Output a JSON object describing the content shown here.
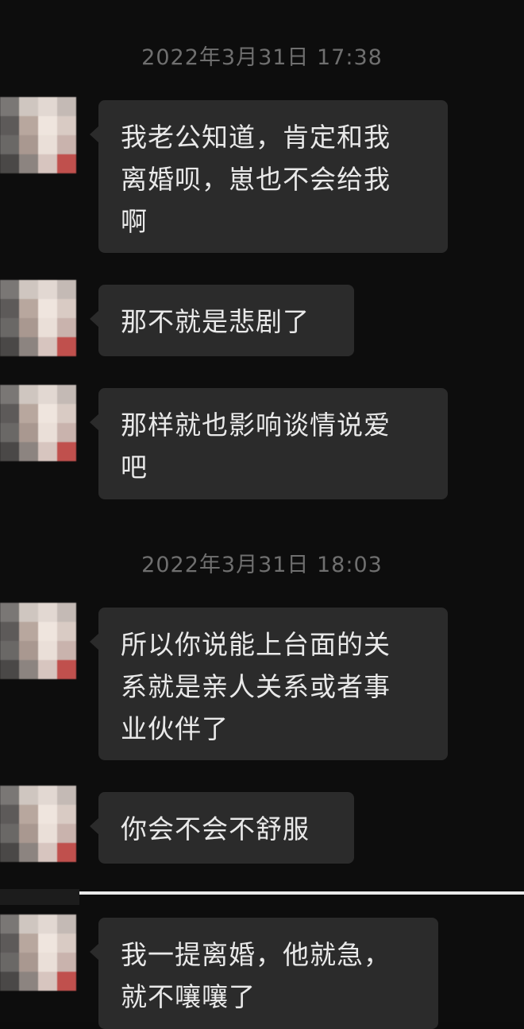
{
  "chat": {
    "timestamps": [
      "2022年3月31日 17:38",
      "2022年3月31日 18:03"
    ],
    "messages": [
      {
        "sender": "contact",
        "text": "我老公知道，肯定和我\n离婚呗，崽也不会给我\n啊"
      },
      {
        "sender": "contact",
        "text": "那不就是悲剧了"
      },
      {
        "sender": "contact",
        "text": "那样就也影响谈情说爱\n吧"
      },
      {
        "sender": "contact",
        "text": "所以你说能上台面的关\n系就是亲人关系或者事\n业伙伴了"
      },
      {
        "sender": "contact",
        "text": "你会不会不舒服"
      },
      {
        "sender": "contact",
        "text": "我一提离婚，他就急，\n就不嚷嚷了"
      }
    ]
  },
  "colors": {
    "background": "#0d0d0d",
    "bubble": "#2b2b2b",
    "bubble_text": "#e9e9e9",
    "timestamp_text": "#6f6f6f"
  }
}
